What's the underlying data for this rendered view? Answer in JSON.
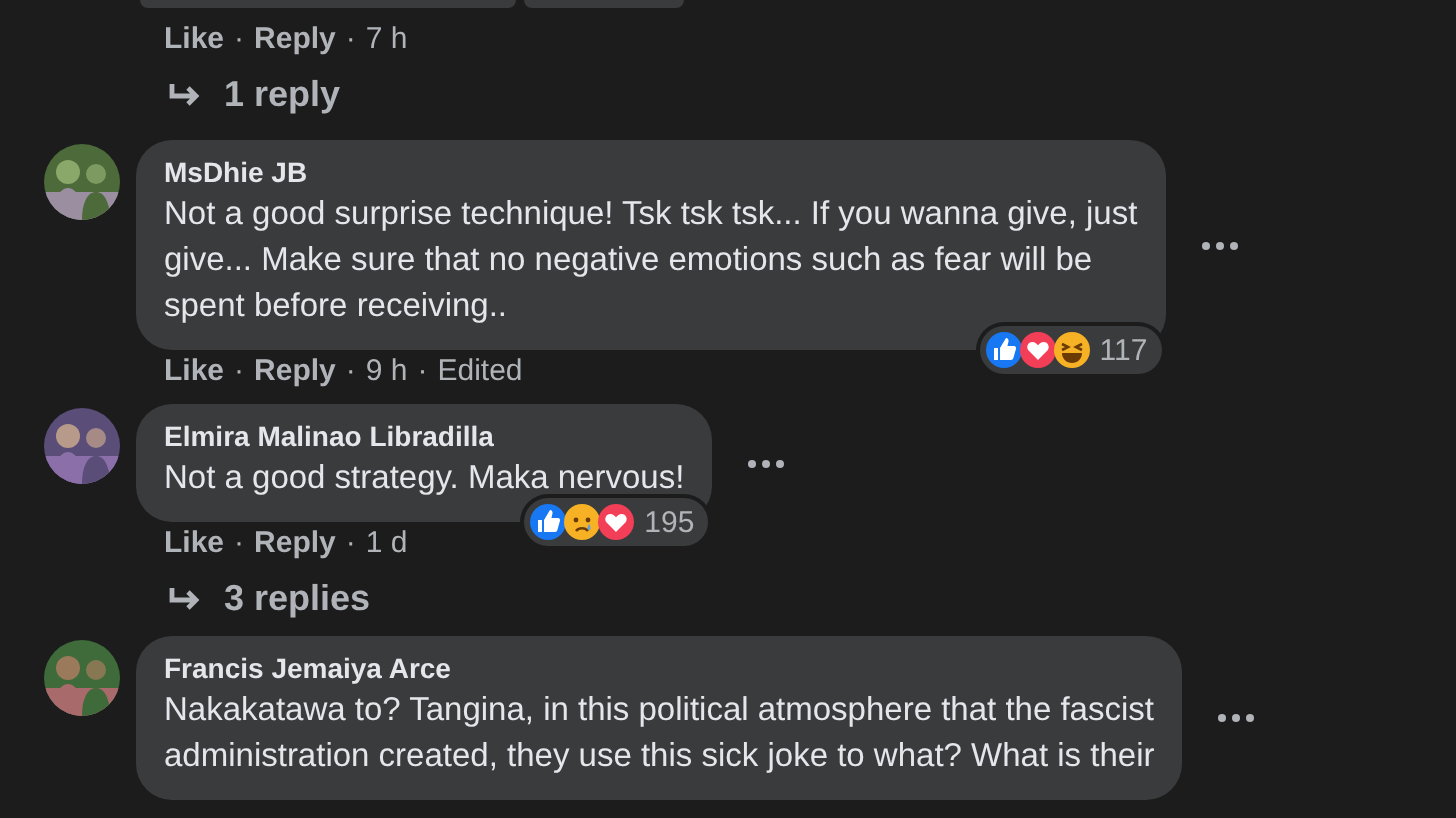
{
  "separator": "·",
  "top_comment": {
    "actions": [
      "Like",
      "Reply"
    ],
    "time": "7 h",
    "replies": "1 reply"
  },
  "comments": [
    {
      "name": "MsDhie JB",
      "body": "Not a good surprise technique! Tsk tsk tsk... If you wanna give, just\ngive... Make sure that no negative emotions such as fear will be\nspent before receiving..",
      "reactions": [
        {
          "kind": "like"
        },
        {
          "kind": "love"
        },
        {
          "kind": "haha"
        }
      ],
      "reaction_count": "117",
      "actions": [
        "Like",
        "Reply"
      ],
      "time": "9 h",
      "edited": "Edited"
    },
    {
      "name": "Elmira Malinao Libradilla",
      "body": "Not a good strategy. Maka nervous!",
      "reactions": [
        {
          "kind": "like"
        },
        {
          "kind": "sad"
        },
        {
          "kind": "love"
        }
      ],
      "reaction_count": "195",
      "actions": [
        "Like",
        "Reply"
      ],
      "time": "1 d",
      "replies": "3 replies"
    },
    {
      "name": "Francis Jemaiya Arce",
      "body": "Nakakatawa to? Tangina, in this political atmosphere that the fascist\nadministration created, they use this sick joke to what? What is their"
    }
  ]
}
